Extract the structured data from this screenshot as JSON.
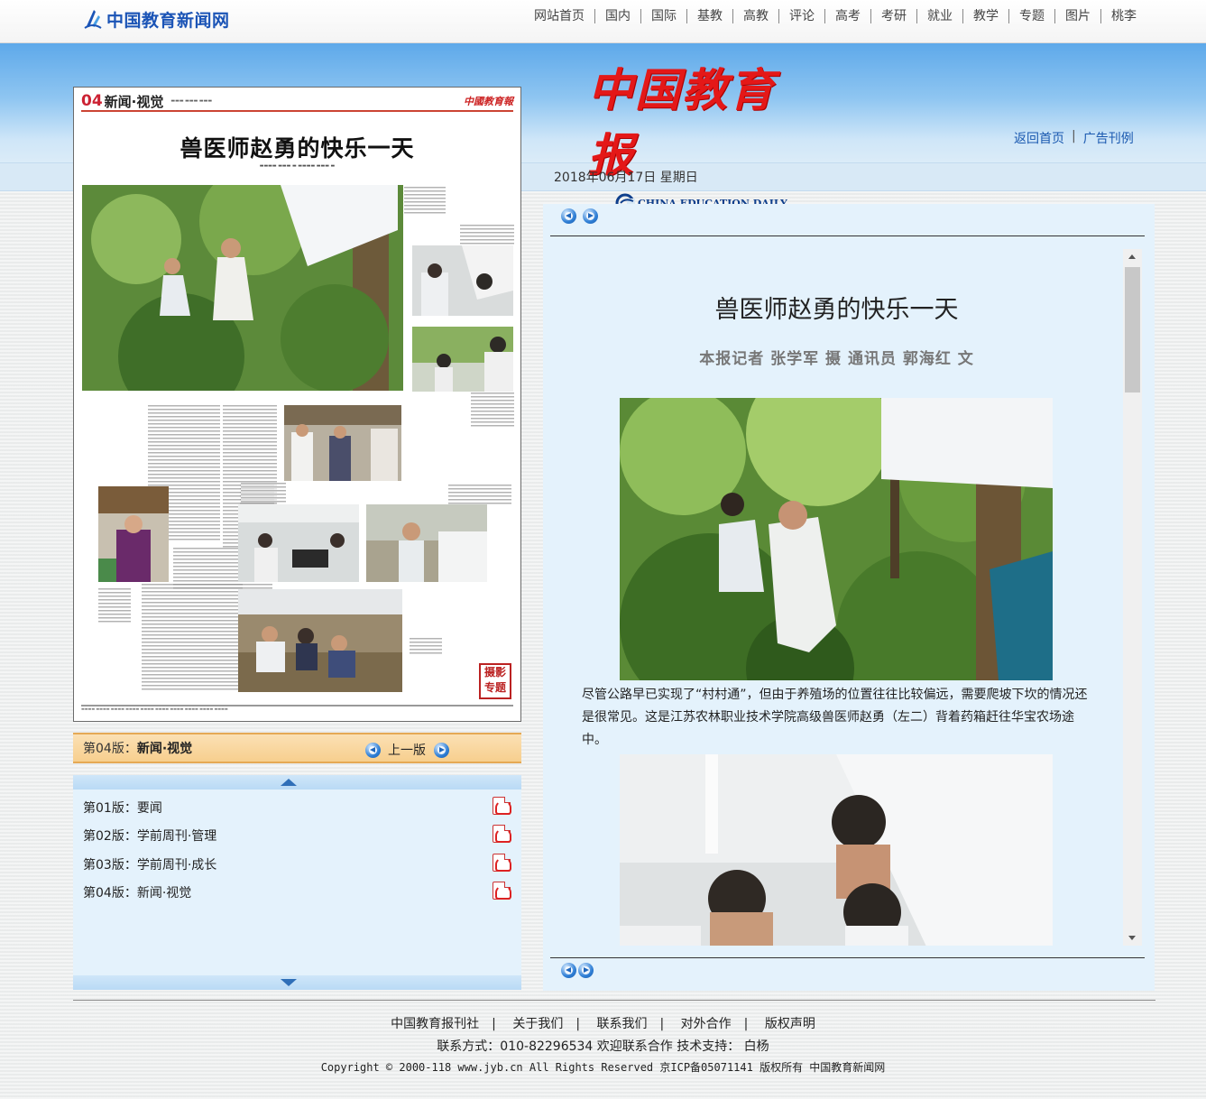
{
  "topbar": {
    "logo_text": "中国教育新闻网",
    "nav": [
      "网站首页",
      "国内",
      "国际",
      "基教",
      "高教",
      "评论",
      "高考",
      "考研",
      "就业",
      "教学",
      "专题",
      "图片",
      "桃李"
    ]
  },
  "header": {
    "paper_name_cn": "中国教育报",
    "paper_name_en": "CHINA EDUCATION DAILY",
    "links": {
      "home": "返回首页",
      "ads": "广告刊例",
      "separator": "|"
    },
    "date": "2018年06月17日  星期日"
  },
  "page_preview": {
    "page_number": "04",
    "section": "新闻·视觉",
    "headline": "兽医师赵勇的快乐一天",
    "brand": "中國教育報",
    "stamp": "摄影专题"
  },
  "edition_bar": {
    "label": "第04版：",
    "current": "新闻·视觉",
    "prev_label": "上一版"
  },
  "editions": [
    {
      "label": "第01版：要闻"
    },
    {
      "label": "第02版：学前周刊·管理"
    },
    {
      "label": "第03版：学前周刊·成长"
    },
    {
      "label": "第04版：新闻·视觉"
    }
  ],
  "article": {
    "title": "兽医师赵勇的快乐一天",
    "byline": "本报记者  张学军  摄  通讯员  郭海红  文",
    "caption": "尽管公路早已实现了“村村通”，但由于养殖场的位置往往比较偏远，需要爬坡下坎的情况还是很常见。这是江苏农林职业技术学院高级兽医师赵勇（左二）背着药箱赶往华宝农场途中。"
  },
  "footer": {
    "links": [
      "中国教育报刊社",
      "关于我们",
      "联系我们",
      "对外合作",
      "版权声明"
    ],
    "contact": "联系方式：010-82296534 欢迎联系合作 技术支持： 白杨",
    "copyright": "Copyright © 2000-118 www.jyb.cn All Rights Reserved 京ICP备05071141 版权所有 中国教育新闻网"
  },
  "colors": {
    "brand_blue": "#1b54b6",
    "paper_red": "#e41818",
    "edition_bar": "#f7cf8e",
    "panel_bg": "#e4f2fc"
  }
}
